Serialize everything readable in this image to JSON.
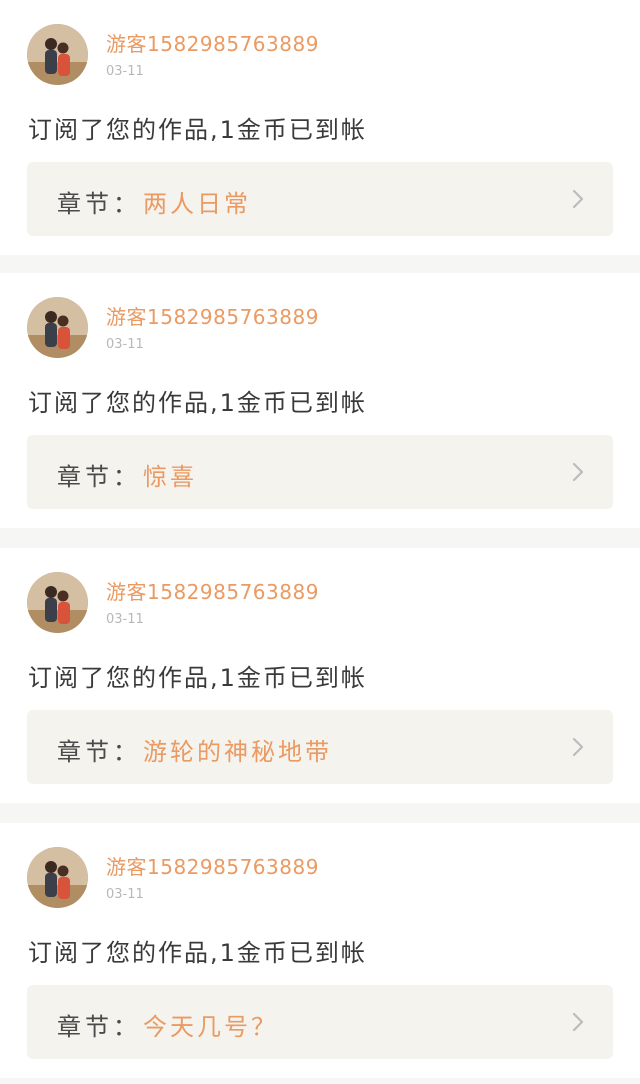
{
  "colors": {
    "accent": "#ea9a62",
    "text": "#3a3a3a",
    "muted": "#b8b8b8",
    "chapter_bg": "#f4f3ee",
    "divider": "#f6f6f4"
  },
  "notifications": [
    {
      "username": "游客15829857​63889",
      "date": "03-11",
      "message": "订阅了您的作品,1金币已到帐",
      "chapter_label": "章节：",
      "chapter_title": "两人日常",
      "avatar_icon": "user-avatar",
      "chevron_icon": "chevron-right-icon"
    },
    {
      "username": "游客15829857​63889",
      "date": "03-11",
      "message": "订阅了您的作品,1金币已到帐",
      "chapter_label": "章节：",
      "chapter_title": "惊喜",
      "avatar_icon": "user-avatar",
      "chevron_icon": "chevron-right-icon"
    },
    {
      "username": "游客15829857​63889",
      "date": "03-11",
      "message": "订阅了您的作品,1金币已到帐",
      "chapter_label": "章节：",
      "chapter_title": "游轮的神秘地带",
      "avatar_icon": "user-avatar",
      "chevron_icon": "chevron-right-icon"
    },
    {
      "username": "游客15829857​63889",
      "date": "03-11",
      "message": "订阅了您的作品,1金币已到帐",
      "chapter_label": "章节：",
      "chapter_title": "今天几号？",
      "avatar_icon": "user-avatar",
      "chevron_icon": "chevron-right-icon"
    }
  ]
}
